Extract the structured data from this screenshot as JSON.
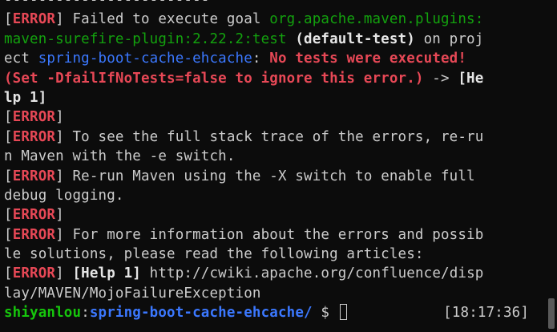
{
  "terminal": {
    "separator": "------------------------",
    "error_tag": "ERROR",
    "lines": {
      "l1a": "Failed to execute goal ",
      "l1b": "org.apache.maven.plugins:",
      "l2a": "maven-surefire-plugin:2.22.2:test",
      "l2b": " (default-test)",
      "l2c": " on proj",
      "l3a": "ect ",
      "l3b": "spring-boot-cache-ehcache",
      "l3c": ": ",
      "l3d": "No tests were executed!",
      "l4a": "(Set -DfailIfNoTests=false to ignore this error.)",
      "l4b": " -> ",
      "l4c": "[He",
      "l5": "lp 1]",
      "l7": " To see the full stack trace of the errors, re-ru",
      "l8": "n Maven with the -e switch.",
      "l9": " Re-run Maven using the -X switch to enable full",
      "l10": "debug logging.",
      "l12": " For more information about the errors and possib",
      "l13": "le solutions, please read the following articles:",
      "l14a": " [Help 1]",
      "l14b": " http://cwiki.apache.org/confluence/disp",
      "l15": "lay/MAVEN/MojoFailureException"
    },
    "prompt": {
      "user": "shiyanlou",
      "sep": ":",
      "path": "spring-boot-cache-ehcache/",
      "symbol": " $ ",
      "time": "[18:17:36]"
    }
  }
}
